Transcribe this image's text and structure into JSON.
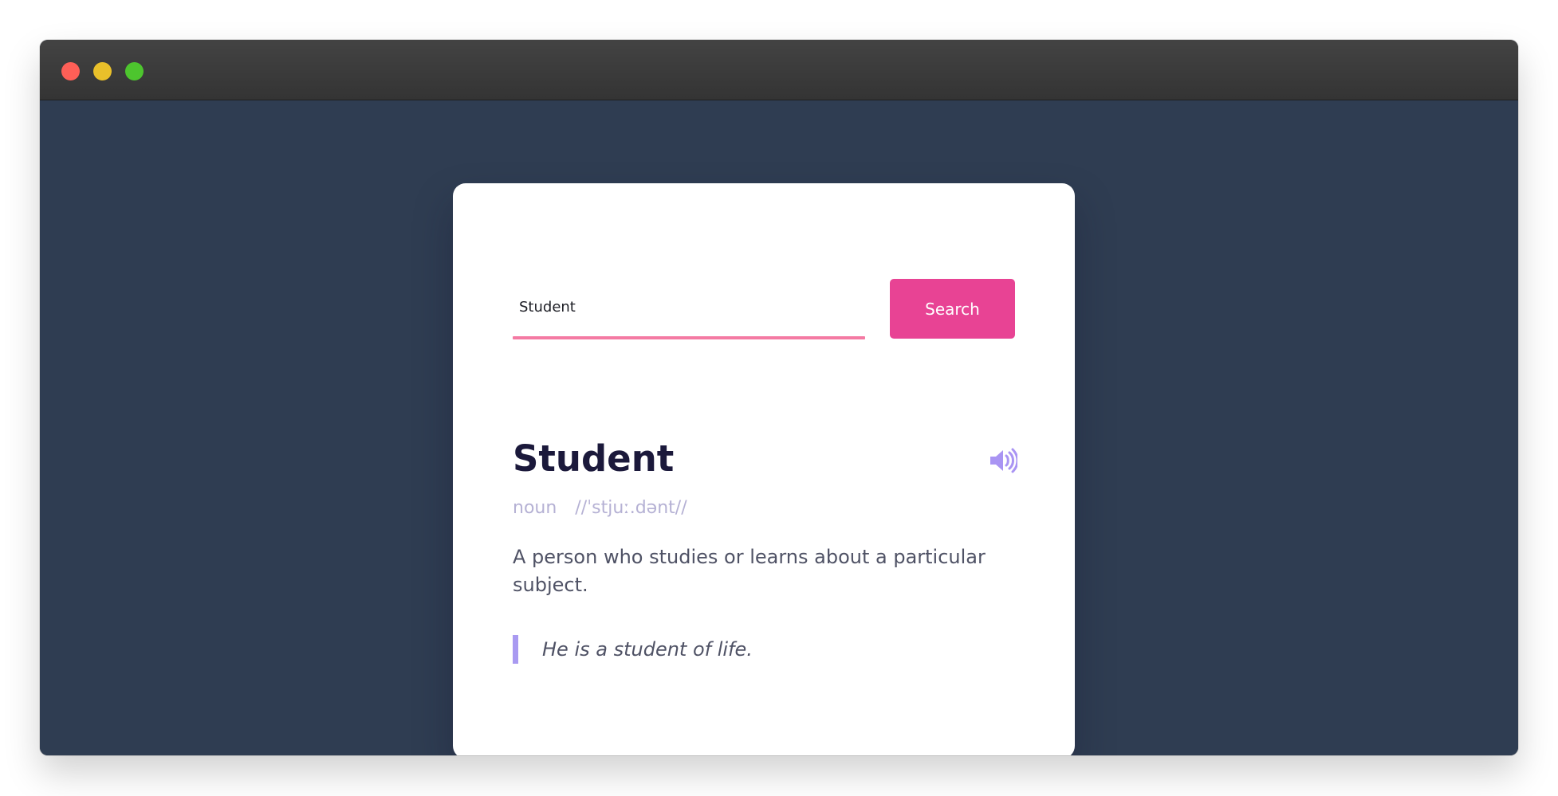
{
  "colors": {
    "window_background": "#2f3d52",
    "card_background": "#ffffff",
    "accent_pink": "#e84394",
    "underline_pink": "#f47aa3",
    "sound_icon": "#a994f3",
    "example_bar": "#a99af1"
  },
  "search": {
    "value": "Student",
    "button_label": "Search",
    "icon": "speaker-icon"
  },
  "result": {
    "word": "Student",
    "part_of_speech": "noun",
    "phonetic": "//ˈstjuː.dənt//",
    "definition": "A person who studies or learns about a particular subject.",
    "example": "He is a student of life."
  }
}
